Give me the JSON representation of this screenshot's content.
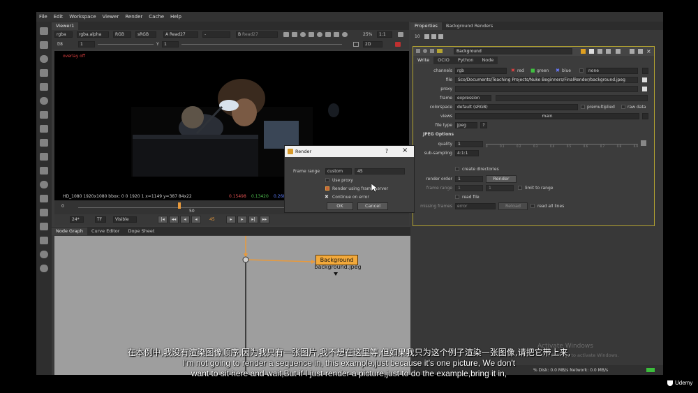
{
  "menu": [
    "File",
    "Edit",
    "Workspace",
    "Viewer",
    "Render",
    "Cache",
    "Help"
  ],
  "viewer": {
    "tab": "Viewer1",
    "channels": "rgba",
    "alpha": "rgba.alpha",
    "colorspace_rgb": "RGB",
    "lut": "sRGB",
    "input_a": "A",
    "input_a_node": "Read27",
    "dash": "-",
    "input_b": "B",
    "input_b_node": "Read27",
    "pct": "25%",
    "ratio": "1:1",
    "fstop": "f/8",
    "gain": "1",
    "y_label": "Y",
    "gamma": "1",
    "mode2d": "2D",
    "overlay": "overlay off",
    "info": "HD_1080 1920x1080  bbox: 0 0 1920 1  x=1149 y=387 84x22",
    "pixel_r": "0.15498",
    "pixel_g": "0.13420",
    "pixel_b": "0.268"
  },
  "timeline": {
    "start": "0",
    "frame_marker": "50",
    "fps": "24*",
    "tf": "TF",
    "visible": "Visible",
    "current_frame": "45"
  },
  "node_tabs": [
    "Node Graph",
    "Curve Editor",
    "Dope Sheet"
  ],
  "node": {
    "name": "Background",
    "sub": "background.jpeg"
  },
  "properties": {
    "tabs": [
      "Properties",
      "Background Renders"
    ],
    "count": "10",
    "node_name": "Background",
    "sub_tabs": [
      "Write",
      "OCIO",
      "Python",
      "Node"
    ],
    "channels_label": "channels",
    "channels": "rgb",
    "red": "red",
    "green": "green",
    "blue": "blue",
    "none": "none",
    "file_label": "file",
    "file": "Sco/Documents/Teaching Projects/Nuke Beginners/FinalRender/background.jpeg",
    "proxy_label": "proxy",
    "frame_label": "frame",
    "frame": "expression",
    "colorspace_label": "colorspace",
    "colorspace": "default (sRGB)",
    "premultiplied": "premultiplied",
    "raw_data": "raw data",
    "views_label": "views",
    "views": "main",
    "filetype_label": "file type",
    "filetype": "jpeg",
    "help": "?",
    "jpeg_options": "JPEG Options",
    "quality_label": "quality",
    "quality": "1",
    "ticks": [
      "0",
      "0.1",
      "0.2",
      "0.3",
      "0.4",
      "0.5",
      "0.6",
      "0.7",
      "0.8",
      "0.9"
    ],
    "subsampling_label": "sub-sampling",
    "subsampling": "4:1:1",
    "create_dirs": "create directories",
    "render_order_label": "render order",
    "render_order": "1",
    "render_btn": "Render",
    "frame_range_label": "frame range",
    "fr_start": "1",
    "fr_end": "1",
    "limit": "limit to range",
    "read_file": "read file",
    "missing_label": "missing frames",
    "missing": "error",
    "reload": "Reload",
    "read_all": "read all lines"
  },
  "dialog": {
    "title": "Render",
    "help": "?",
    "close": "×",
    "frame_range_label": "Frame range",
    "frame_range_mode": "custom",
    "frame_range_value": "45",
    "use_proxy": "Use proxy",
    "frame_server": "Render using frame server",
    "continue_error": "Continue on error",
    "ok": "OK",
    "cancel": "Cancel"
  },
  "status": {
    "text": "% Disk: 0.0 MB/s Network: 0.0 MB/s"
  },
  "watermark": {
    "line1": "Activate Windows",
    "line2": "Go to Settings to activate Windows."
  },
  "subtitle": {
    "zh": "在本例中,我没有渲染图像顺序,因为我只有一张图片,我不想在这里等,但如果我只为这个例子渲染一张图像,请把它带上来,",
    "en1": "I'm not going to render a sequence in, this example,just because it's one picture, We don't",
    "en2": "want to sit here and wait,But if I just render a picture,just to do the example,bring it in,"
  },
  "brand": "Udemy",
  "colors": {
    "accent_yellow": "#b5a531",
    "node_orange": "#f2a93b",
    "pipe": "#e89a3c"
  }
}
